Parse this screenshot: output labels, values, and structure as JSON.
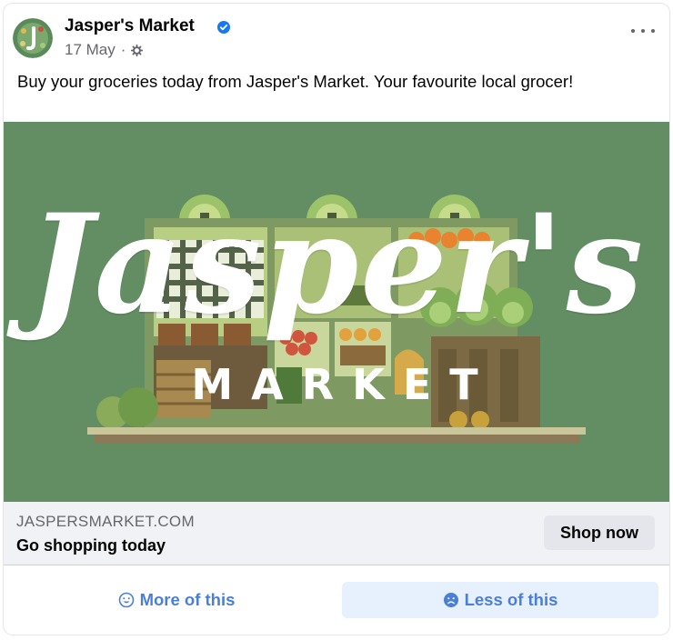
{
  "post": {
    "page_name": "Jasper's Market",
    "date": "17 May",
    "separator": "·",
    "text": "Buy your groceries today from Jasper's Market. Your favourite local grocer!",
    "icons": {
      "verified": "verified-badge-icon",
      "audience": "gear-icon",
      "more": "more-options-icon"
    }
  },
  "creative": {
    "brand_script": "Jasper's",
    "brand_sub": "MARKET",
    "background_color": "#638e63"
  },
  "link": {
    "domain": "JASPERSMARKET.COM",
    "headline": "Go shopping today",
    "cta": "Shop now"
  },
  "feedback": {
    "more_label": "More of this",
    "less_label": "Less of this",
    "accent": "#4b7fd6"
  }
}
